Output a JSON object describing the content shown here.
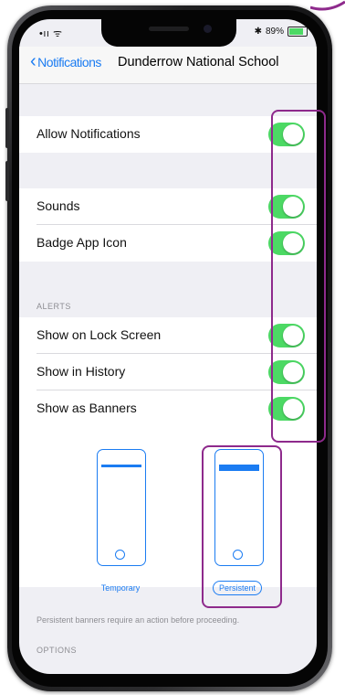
{
  "status_bar": {
    "left": "•ıı ᯤ",
    "battery": "89%",
    "bluetooth": "✱"
  },
  "nav": {
    "back_label": "Notifications",
    "title": "Dunderrow National School"
  },
  "rows": {
    "allow_notifications": "Allow Notifications",
    "sounds": "Sounds",
    "badge_app_icon": "Badge App Icon",
    "show_on_lock_screen": "Show on Lock Screen",
    "show_in_history": "Show in History",
    "show_as_banners": "Show as Banners"
  },
  "toggles_on": [
    true,
    true,
    true,
    true,
    true,
    true
  ],
  "sections": {
    "alerts": "ALERTS",
    "options": "OPTIONS"
  },
  "banner_styles": {
    "temporary": "Temporary",
    "persistent": "Persistent",
    "selected": "Persistent"
  },
  "footer_note": "Persistent banners require an action before proceeding.",
  "colors": {
    "accent": "#1b7cf2",
    "toggle_on": "#4cd964",
    "highlight": "#8e2a8c"
  }
}
